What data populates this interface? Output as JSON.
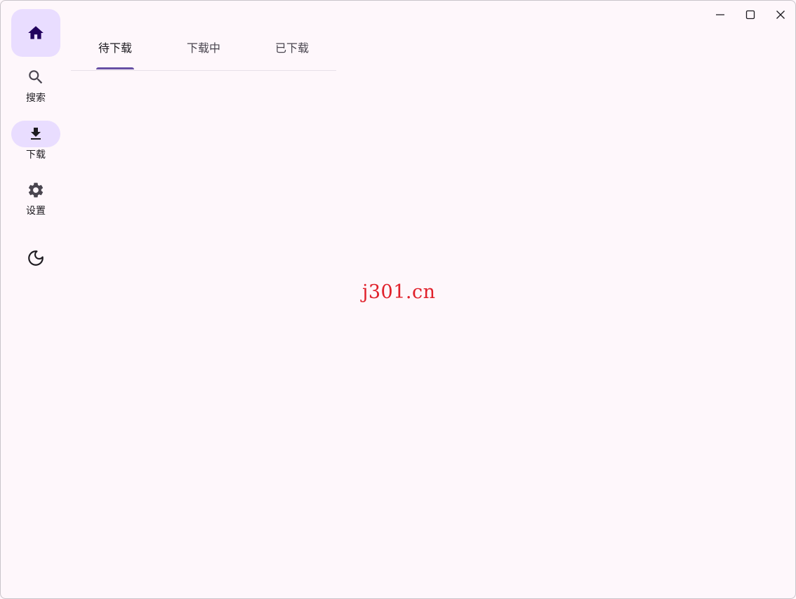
{
  "nav": {
    "home_icon": "home-icon",
    "items": [
      {
        "label": "搜索",
        "icon": "search-icon"
      },
      {
        "label": "下载",
        "icon": "download-icon"
      },
      {
        "label": "设置",
        "icon": "gear-icon"
      }
    ],
    "theme_icon": "moon-icon"
  },
  "tabs": [
    {
      "label": "待下载",
      "active": true
    },
    {
      "label": "下载中",
      "active": false
    },
    {
      "label": "已下载",
      "active": false
    }
  ],
  "window_controls": [
    "minimize-icon",
    "maximize-icon",
    "close-icon"
  ],
  "watermark": "j301.cn",
  "colors": {
    "background": "#fef7fb",
    "accent": "#6750a4",
    "accent_container": "#e9ddff",
    "home_icon": "#21005d",
    "watermark": "#e0202a"
  }
}
